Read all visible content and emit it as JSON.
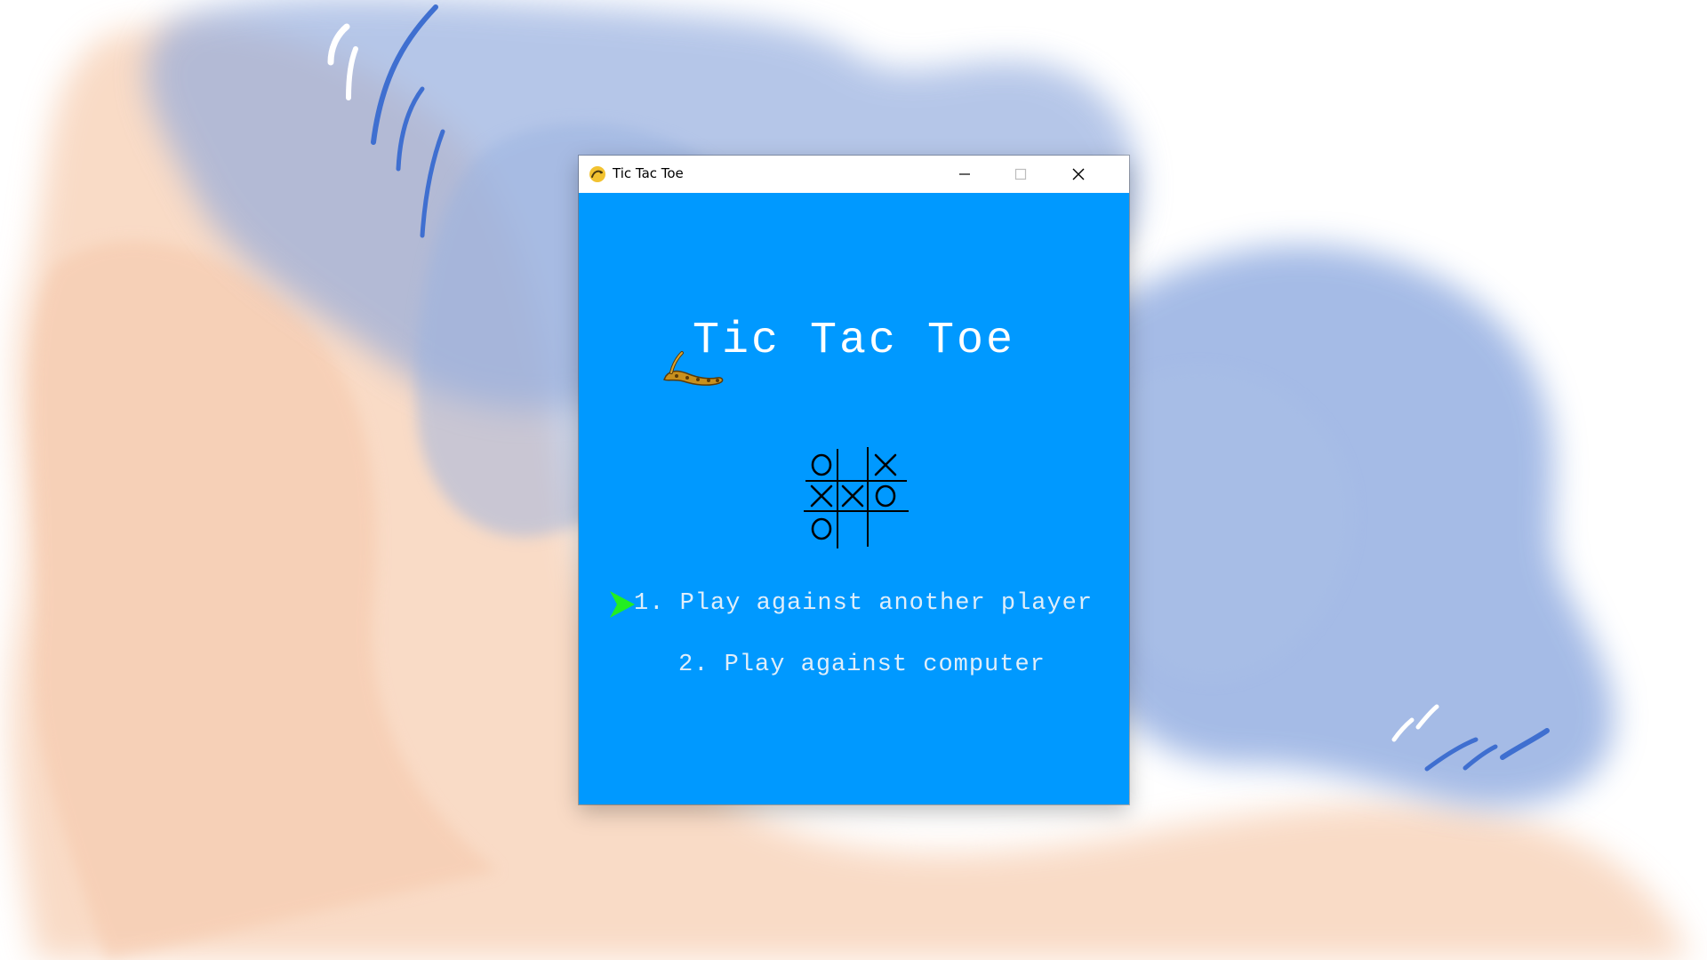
{
  "window": {
    "title": "Tic Tac Toe",
    "app_icon": "pygame-snake-icon",
    "controls": [
      "minimize-icon",
      "maximize-icon",
      "close-icon"
    ]
  },
  "game": {
    "title": "Tic Tac Toe",
    "background_color": "#0099ff",
    "board": [
      [
        "O",
        "",
        "X"
      ],
      [
        "X",
        "X",
        "O"
      ],
      [
        "O",
        "",
        ""
      ]
    ],
    "menu": {
      "selected_index": 0,
      "selector_icon": "arrow-right-icon",
      "selector_color": "#22ee22",
      "items": [
        "1. Play against another player",
        "2. Play against computer"
      ]
    }
  }
}
